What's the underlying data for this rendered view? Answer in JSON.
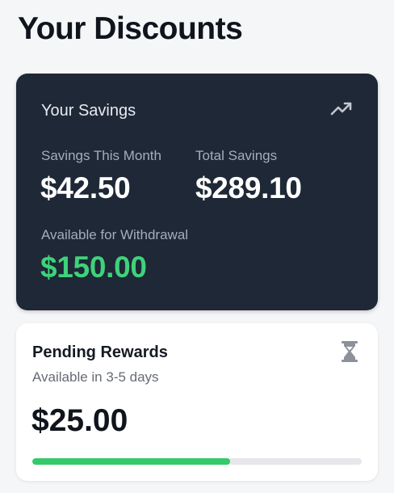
{
  "page": {
    "title": "Your Discounts"
  },
  "savings_card": {
    "title": "Your Savings",
    "icon": "trending-up-icon",
    "month_label": "Savings This Month",
    "month_value": "$42.50",
    "total_label": "Total Savings",
    "total_value": "$289.10",
    "withdraw_label": "Available for Withdrawal",
    "withdraw_value": "$150.00",
    "withdraw_color": "#3fd27a",
    "background": "#1e2836"
  },
  "pending_card": {
    "title": "Pending Rewards",
    "icon": "hourglass-icon",
    "subtitle": "Available in 3-5 days",
    "amount": "$25.00",
    "progress_fraction": 0.6,
    "progress_color": "#34c96a"
  }
}
